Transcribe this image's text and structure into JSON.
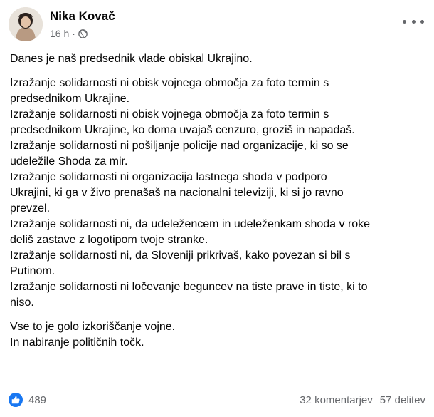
{
  "post": {
    "author": "Nika Kovač",
    "time": "16 h",
    "paragraphs": [
      [
        "Danes je naš predsednik vlade obiskal Ukrajino."
      ],
      [
        "Izražanje solidarnosti ni obisk vojnega območja za foto termin s",
        "predsednikom Ukrajine.",
        "Izražanje solidarnosti ni obisk vojnega območja za foto termin s",
        "predsednikom Ukrajine, ko doma uvajaš cenzuro, groziš in napadaš.",
        "Izražanje solidarnosti ni pošiljanje policije nad organizacije, ki so se",
        "udeležile Shoda za mir.",
        "Izražanje solidarnosti ni organizacija lastnega shoda v podporo",
        "Ukrajini, ki ga v živo prenašaš na nacionalni televiziji, ki si jo ravno",
        "prevzel.",
        "Izražanje solidarnosti ni, da udeležencem in udeleženkam shoda v roke",
        "deliš zastave z logotipom tvoje stranke.",
        "Izražanje solidarnosti ni, da Sloveniji prikrivaš, kako povezan si bil s",
        "Putinom.",
        "Izražanje solidarnosti ni ločevanje beguncev na tiste prave in tiste, ki to",
        "niso."
      ],
      [
        "Vse to je golo izkoriščanje vojne.",
        "In nabiranje političnih točk."
      ]
    ]
  },
  "footer": {
    "reactions": "489",
    "comments": "32 komentarjev",
    "shares": "57 delitev"
  },
  "colors": {
    "like_blue": "#1877f2",
    "meta_gray": "#65676b"
  },
  "icons": [
    "globe-icon",
    "more-icon",
    "like-icon"
  ]
}
